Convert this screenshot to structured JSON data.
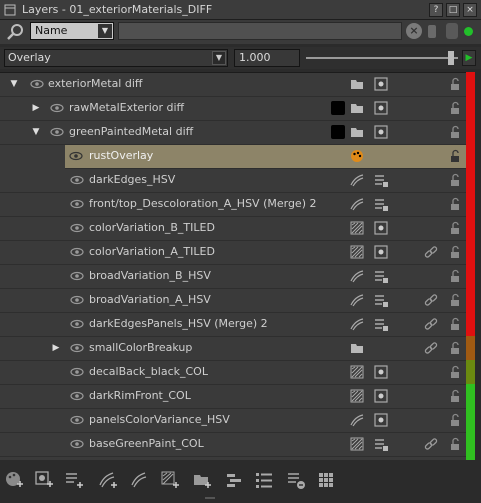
{
  "window": {
    "title": "Layers - 01_exteriorMaterials_DIFF",
    "buttons": [
      "?",
      "□",
      "×"
    ]
  },
  "search": {
    "filter_value": "Name",
    "value": "",
    "placeholder": ""
  },
  "blend": {
    "mode": "Overlay",
    "opacity": "1.000"
  },
  "layers": [
    {
      "name": "exteriorMetal diff",
      "expanded": true,
      "level": 0
    },
    {
      "name": "rawMetalExterior  diff",
      "expanded": false,
      "level": 1,
      "swatch": true
    },
    {
      "name": "greenPaintedMetal  diff",
      "expanded": true,
      "level": 1,
      "swatch": true
    },
    {
      "name": "rustOverlay",
      "level": 2,
      "selected": true
    },
    {
      "name": "darkEdges_HSV",
      "level": 2
    },
    {
      "name": "front/top_Descoloration_A_HSV (Merge) 2",
      "level": 2
    },
    {
      "name": "colorVariation_B_TILED",
      "level": 2
    },
    {
      "name": "colorVariation_A_TILED",
      "level": 2
    },
    {
      "name": "broadVariation_B_HSV",
      "level": 2
    },
    {
      "name": "broadVariation_A_HSV",
      "level": 2
    },
    {
      "name": "darkEdgesPanels_HSV (Merge) 2",
      "level": 2
    },
    {
      "name": "smallColorBreakup",
      "expanded": false,
      "level": 2
    },
    {
      "name": "decalBack_black_COL",
      "level": 2
    },
    {
      "name": "darkRimFront_COL",
      "level": 2
    },
    {
      "name": "panelsColorVariance_HSV",
      "level": 2
    },
    {
      "name": "baseGreenPaint_COL",
      "level": 2
    }
  ],
  "colors": {
    "selected_row": "#8d8468",
    "status_green": "#22c02a",
    "bar_red": "#e01010",
    "bar_orange": "#a05a12",
    "bar_olive": "#6b8a10",
    "bar_green": "#30c020"
  }
}
